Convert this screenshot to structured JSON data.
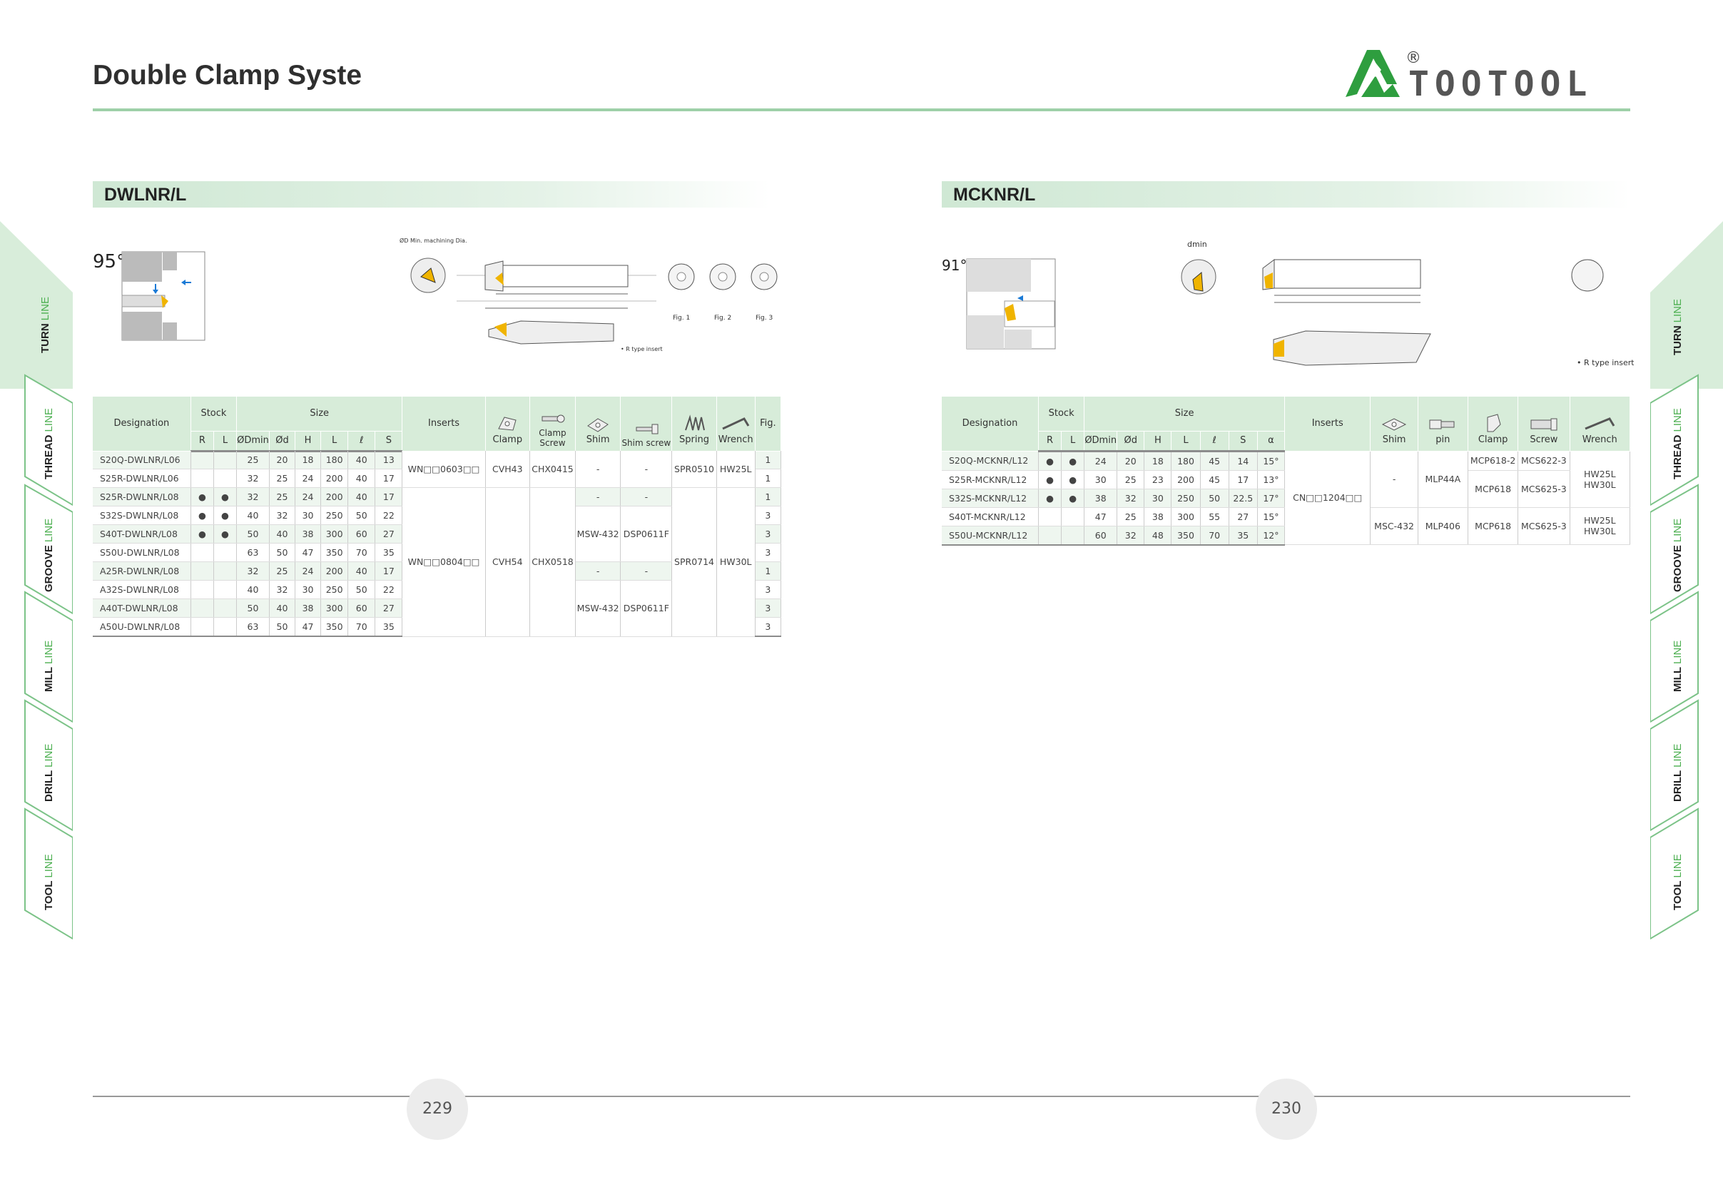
{
  "header": {
    "title": "Double Clamp Syste",
    "logo_text": "TOOTOOL",
    "logo_mark": "®"
  },
  "sections": {
    "left": {
      "title": "DWLNR/L",
      "angle": "95°",
      "note": "• R type insert",
      "dim_note": "ØD Min. machining Dia.",
      "fig_labels": [
        "Fig. 1",
        "Fig. 2",
        "Fig. 3"
      ]
    },
    "right": {
      "title": "MCKNR/L",
      "angle": "91°",
      "note": "• R type insert",
      "dmin": "dmin"
    }
  },
  "side_tabs": [
    {
      "main": "TURN",
      "line": "LINE"
    },
    {
      "main": "THREAD",
      "line": "LINE"
    },
    {
      "main": "GROOVE",
      "line": "LINE"
    },
    {
      "main": "MILL",
      "line": "LINE"
    },
    {
      "main": "DRILL",
      "line": "LINE"
    },
    {
      "main": "TOOL",
      "line": "LINE"
    }
  ],
  "table1": {
    "headers": {
      "designation": "Designation",
      "stock": "Stock",
      "size": "Size",
      "inserts": "Inserts",
      "clamp": "Clamp",
      "clamp_screw": "Clamp Screw",
      "shim": "Shim",
      "shim_screw": "Shim screw",
      "spring": "Spring",
      "wrench": "Wrench",
      "fig": "Fig.",
      "sub": [
        "R",
        "L",
        "ØDmin",
        "Ød",
        "H",
        "L",
        "ℓ",
        "S"
      ]
    },
    "rows": [
      {
        "d": "S20Q-DWLNR/L06",
        "r": "",
        "l": "",
        "v": [
          "25",
          "20",
          "18",
          "180",
          "40",
          "13"
        ],
        "fig": "1"
      },
      {
        "d": "S25R-DWLNR/L06",
        "r": "",
        "l": "",
        "v": [
          "32",
          "25",
          "24",
          "200",
          "40",
          "17"
        ],
        "fig": "1"
      },
      {
        "d": "S25R-DWLNR/L08",
        "r": "●",
        "l": "●",
        "v": [
          "32",
          "25",
          "24",
          "200",
          "40",
          "17"
        ],
        "fig": "1"
      },
      {
        "d": "S32S-DWLNR/L08",
        "r": "●",
        "l": "●",
        "v": [
          "40",
          "32",
          "30",
          "250",
          "50",
          "22"
        ],
        "fig": "3"
      },
      {
        "d": "S40T-DWLNR/L08",
        "r": "●",
        "l": "●",
        "v": [
          "50",
          "40",
          "38",
          "300",
          "60",
          "27"
        ],
        "fig": "3"
      },
      {
        "d": "S50U-DWLNR/L08",
        "r": "",
        "l": "",
        "v": [
          "63",
          "50",
          "47",
          "350",
          "70",
          "35"
        ],
        "fig": "3"
      },
      {
        "d": "A25R-DWLNR/L08",
        "r": "",
        "l": "",
        "v": [
          "32",
          "25",
          "24",
          "200",
          "40",
          "17"
        ],
        "fig": "1"
      },
      {
        "d": "A32S-DWLNR/L08",
        "r": "",
        "l": "",
        "v": [
          "40",
          "32",
          "30",
          "250",
          "50",
          "22"
        ],
        "fig": "3"
      },
      {
        "d": "A40T-DWLNR/L08",
        "r": "",
        "l": "",
        "v": [
          "50",
          "40",
          "38",
          "300",
          "60",
          "27"
        ],
        "fig": "3"
      },
      {
        "d": "A50U-DWLNR/L08",
        "r": "",
        "l": "",
        "v": [
          "63",
          "50",
          "47",
          "350",
          "70",
          "35"
        ],
        "fig": "3"
      }
    ],
    "merged": {
      "insert_a": "WN□□0603□□",
      "clamp_a": "CVH43",
      "screw_a": "CHX0415",
      "spring_a": "SPR0510",
      "wrench_a": "HW25L",
      "insert_b": "WN□□0804□□",
      "clamp_b": "CVH54",
      "screw_b": "CHX0518",
      "spring_b": "SPR0714",
      "wrench_b": "HW30L",
      "dash": "-",
      "shim": "MSW-432",
      "shim_screw": "DSP0611F"
    }
  },
  "table2": {
    "headers": {
      "designation": "Designation",
      "stock": "Stock",
      "size": "Size",
      "inserts": "Inserts",
      "shim": "Shim",
      "pin": "pin",
      "clamp": "Clamp",
      "screw": "Screw",
      "wrench": "Wrench",
      "sub": [
        "R",
        "L",
        "ØDmin",
        "Ød",
        "H",
        "L",
        "ℓ",
        "S",
        "α"
      ]
    },
    "rows": [
      {
        "d": "S20Q-MCKNR/L12",
        "r": "●",
        "l": "●",
        "v": [
          "24",
          "20",
          "18",
          "180",
          "45",
          "14",
          "15°"
        ]
      },
      {
        "d": "S25R-MCKNR/L12",
        "r": "●",
        "l": "●",
        "v": [
          "30",
          "25",
          "23",
          "200",
          "45",
          "17",
          "13°"
        ]
      },
      {
        "d": "S32S-MCKNR/L12",
        "r": "●",
        "l": "●",
        "v": [
          "38",
          "32",
          "30",
          "250",
          "50",
          "22.5",
          "17°"
        ]
      },
      {
        "d": "S40T-MCKNR/L12",
        "r": "",
        "l": "",
        "v": [
          "47",
          "25",
          "38",
          "300",
          "55",
          "27",
          "15°"
        ]
      },
      {
        "d": "S50U-MCKNR/L12",
        "r": "",
        "l": "",
        "v": [
          "60",
          "32",
          "48",
          "350",
          "70",
          "35",
          "12°"
        ]
      }
    ],
    "merged": {
      "insert": "CN□□1204□□",
      "shim_dash": "-",
      "shim": "MSC-432",
      "pin_a": "MLP44A",
      "pin_b": "MLP406",
      "clamp_1": "MCP618-2",
      "clamp_2": "MCP618",
      "clamp_b": "MCP618",
      "screw_1": "MCS622-3",
      "screw_2": "MCS625-3",
      "screw_b": "MCS625-3",
      "wrench_a1": "HW25L",
      "wrench_a2": "HW30L",
      "wrench_b1": "HW25L",
      "wrench_b2": "HW30L"
    }
  },
  "footer": {
    "page_left": "229",
    "page_right": "230"
  },
  "colors": {
    "accent": "#3aa655",
    "header_fill": "#d7ecd9",
    "rule": "#9ed0a8"
  }
}
